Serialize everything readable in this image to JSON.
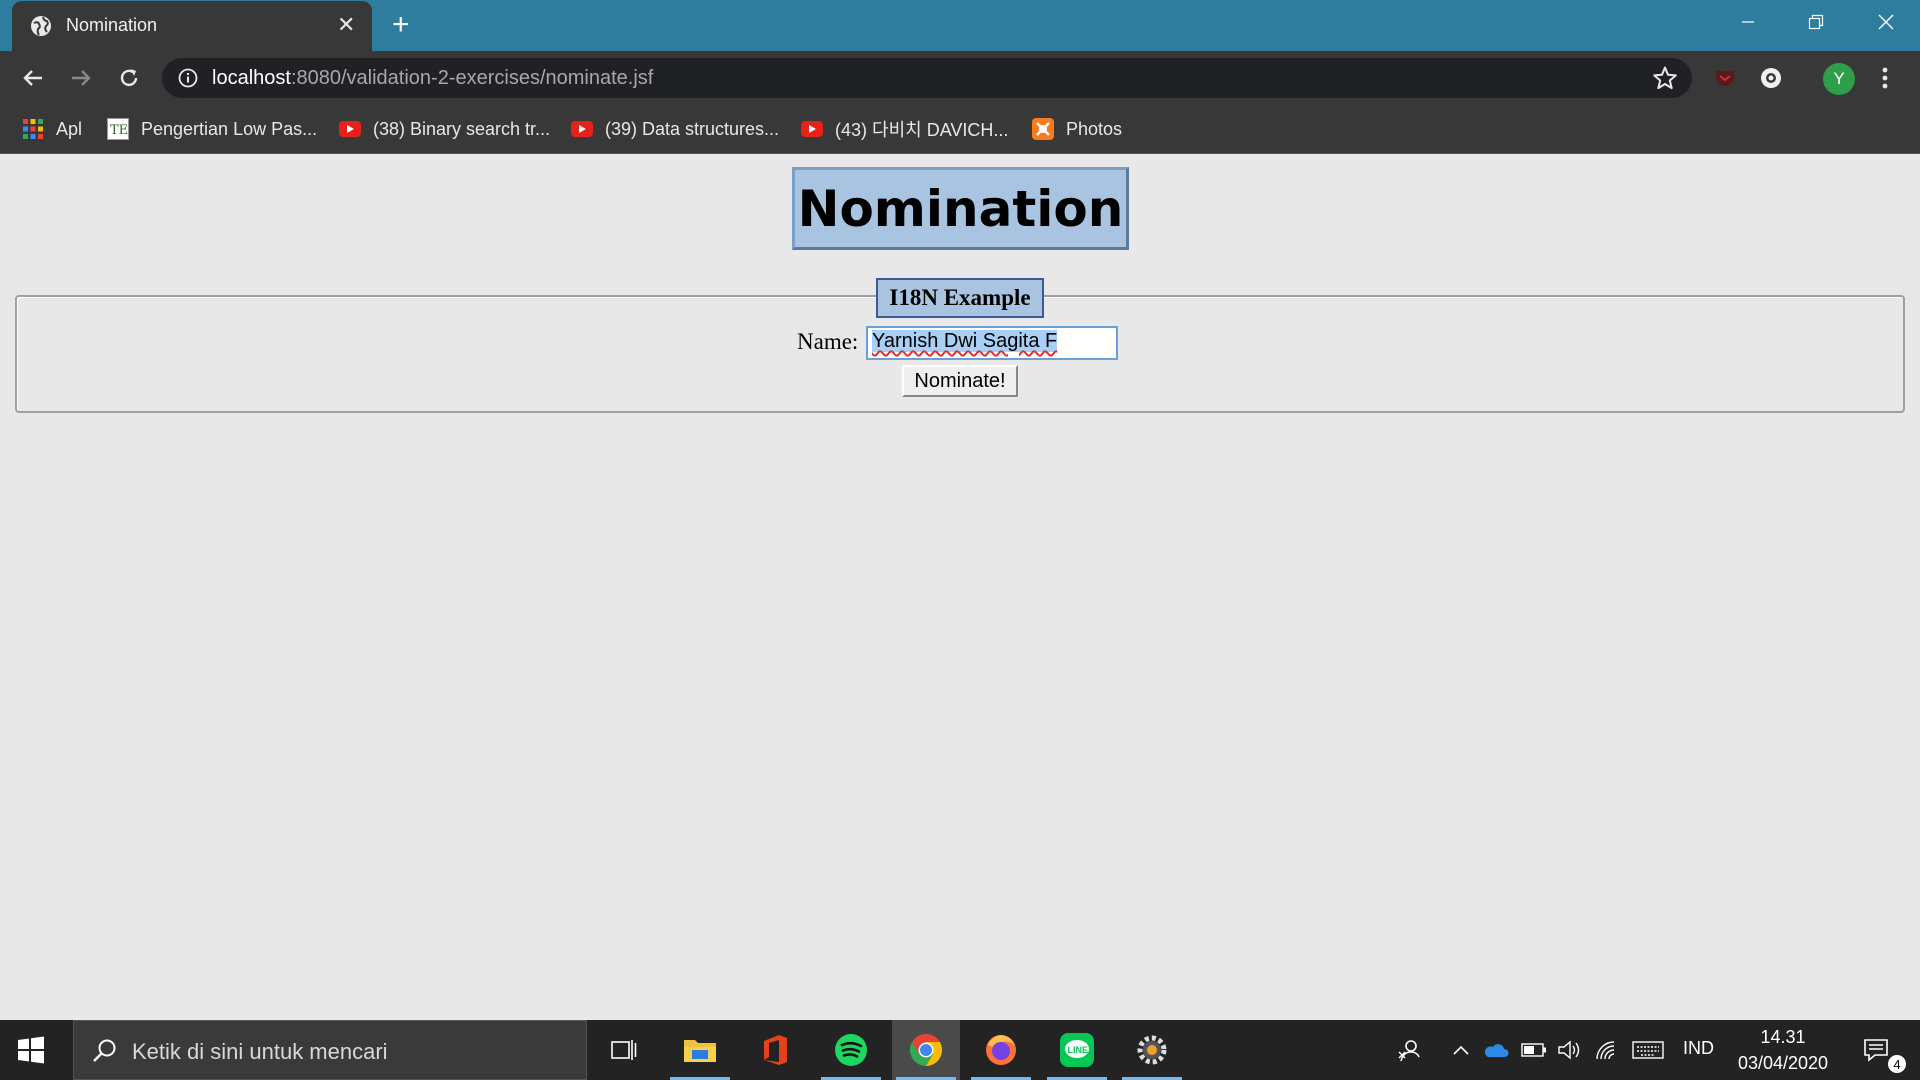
{
  "browser": {
    "tab": {
      "title": "Nomination",
      "close_glyph": "✕",
      "icon": "globe-icon"
    },
    "new_tab_glyph": "+",
    "url_host": "localhost",
    "url_path": ":8080/validation-2-exercises/nominate.jsf",
    "profile_initial": "Y"
  },
  "bookmarks": [
    {
      "label": "Apl",
      "icon": "apps-grid-icon"
    },
    {
      "label": "Pengertian Low Pas...",
      "icon": "te-favicon-icon"
    },
    {
      "label": "(38) Binary search tr...",
      "icon": "youtube-icon"
    },
    {
      "label": "(39) Data structures...",
      "icon": "youtube-icon"
    },
    {
      "label": "(43) 다비치 DAVICH...",
      "icon": "youtube-icon"
    },
    {
      "label": "Photos",
      "icon": "photos-icon"
    }
  ],
  "page": {
    "heading": "Nomination",
    "legend": "I18N Example",
    "name_label": "Name:",
    "name_value": "Yarnish Dwi Sagita F",
    "submit_label": "Nominate!"
  },
  "taskbar": {
    "search_placeholder": "Ketik di sini untuk mencari",
    "language": "IND",
    "time": "14.31",
    "date": "03/04/2020",
    "notification_count": "4"
  },
  "colors": {
    "titlebar": "#2e7d9f",
    "toolbar": "#383838",
    "page_bg": "#e8e8e8",
    "heading_bg": "#a9c4e0",
    "taskbar": "#232323"
  }
}
